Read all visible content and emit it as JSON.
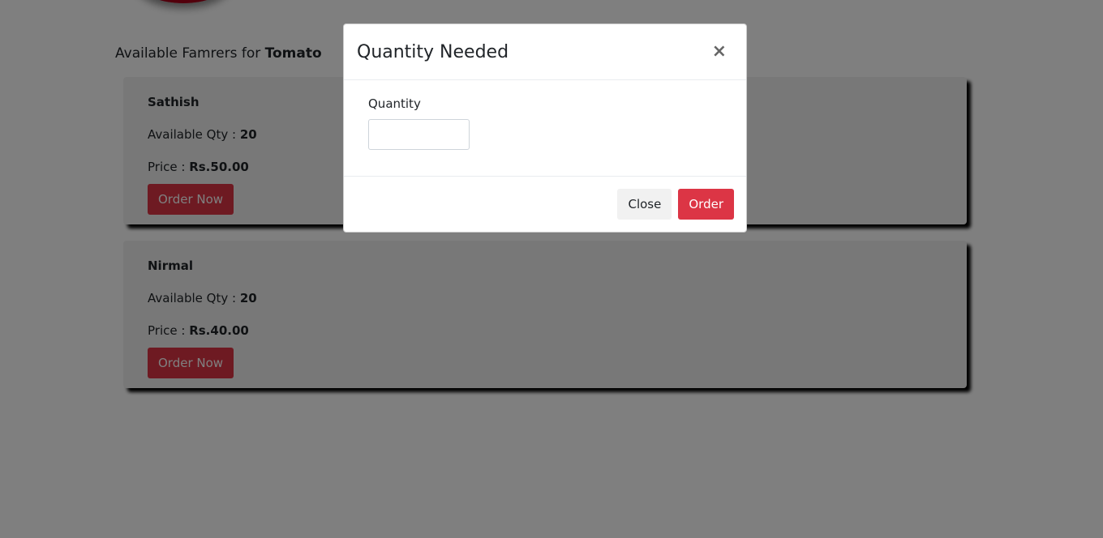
{
  "heading": {
    "prefix": "Available Famrers for",
    "product": "Tomato"
  },
  "farmers": [
    {
      "name": "Sathish",
      "qty_label": "Available Qty :",
      "qty": "20",
      "price_label": "Price :",
      "price": "Rs.50.00",
      "button": "Order Now"
    },
    {
      "name": "Nirmal",
      "qty_label": "Available Qty :",
      "qty": "20",
      "price_label": "Price :",
      "price": "Rs.40.00",
      "button": "Order Now"
    }
  ],
  "modal": {
    "title": "Quantity Needed",
    "close_symbol": "×",
    "field_label": "Quantity",
    "quantity_value": "",
    "close_button": "Close",
    "order_button": "Order"
  },
  "colors": {
    "accent": "#dc3545",
    "card_bg": "#f1f1f1",
    "backdrop": "rgba(0,0,0,0.5)"
  }
}
